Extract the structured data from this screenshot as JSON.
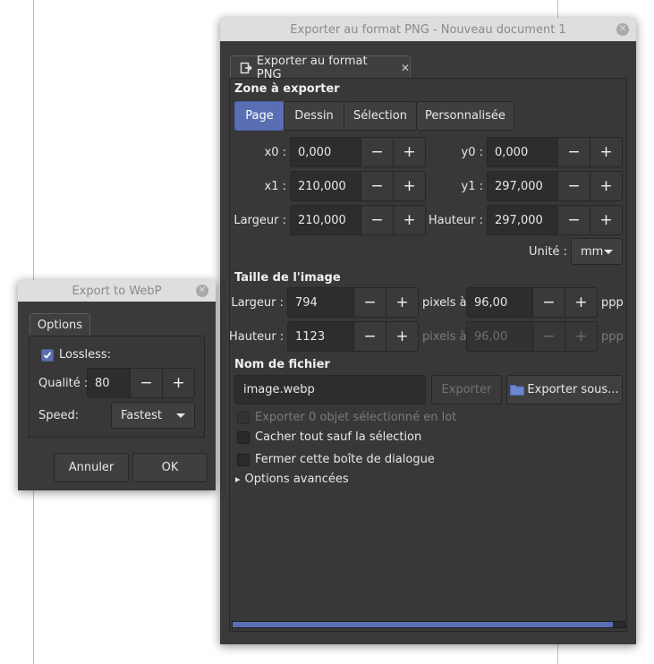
{
  "png_dialog": {
    "title": "Exporter au format PNG - Nouveau document 1",
    "tab_label": "Exporter au format PNG",
    "export_area": {
      "heading": "Zone à exporter",
      "modes": [
        "Page",
        "Dessin",
        "Sélection",
        "Personnalisée"
      ],
      "active_mode": "Page",
      "x0": {
        "label": "x0 :",
        "value": "0,000"
      },
      "y0": {
        "label": "y0 :",
        "value": "0,000"
      },
      "x1": {
        "label": "x1 :",
        "value": "210,000"
      },
      "y1": {
        "label": "y1 :",
        "value": "297,000"
      },
      "width": {
        "label": "Largeur :",
        "value": "210,000"
      },
      "height": {
        "label": "Hauteur :",
        "value": "297,000"
      },
      "unit_label": "Unité :",
      "unit_value": "mm"
    },
    "image_size": {
      "heading": "Taille de l'image",
      "width_label": "Largeur :",
      "width_value": "794",
      "height_label": "Hauteur :",
      "height_value": "1123",
      "pixels_at": "pixels à",
      "dpi_value": "96,00",
      "dpi_value_2": "96,00",
      "dpi_unit": "ppp"
    },
    "filename": {
      "heading": "Nom de fichier",
      "value": "image.webp",
      "export_button": "Exporter",
      "export_as_button": "Exporter sous..."
    },
    "options": {
      "batch": "Exporter 0 objet sélectionné en lot",
      "hide_all": "Cacher tout sauf la sélection",
      "close_dialog": "Fermer cette boîte de dialogue",
      "advanced": "Options avancées"
    },
    "progress_fraction": 0.97
  },
  "webp_dialog": {
    "title": "Export to WebP",
    "tab_label": "Options",
    "lossless_label": "Lossless:",
    "lossless_checked": true,
    "quality_label": "Qualité :",
    "quality_value": "80",
    "speed_label": "Speed:",
    "speed_value": "Fastest",
    "cancel_button": "Annuler",
    "ok_button": "OK"
  },
  "icons": {
    "minus": "−",
    "plus": "+",
    "close": "✕",
    "check": "✓",
    "expander": "▸"
  }
}
